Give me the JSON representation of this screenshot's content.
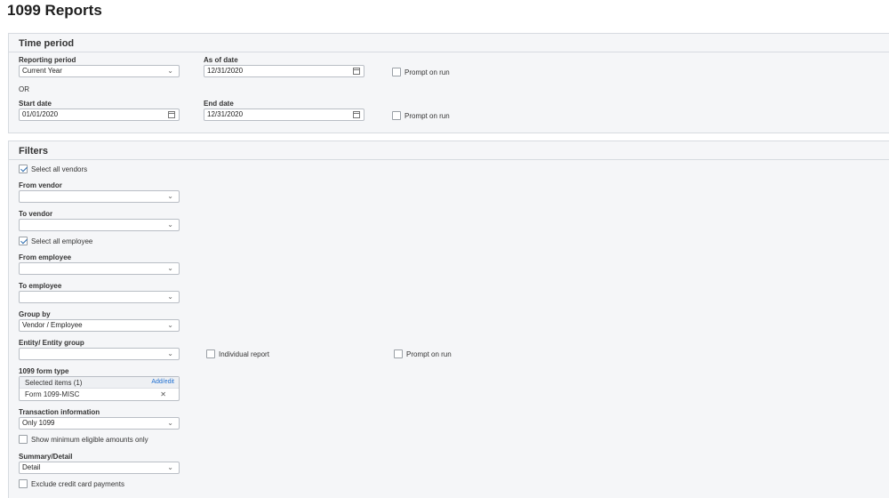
{
  "page": {
    "title": "1099 Reports"
  },
  "time_period": {
    "title": "Time period",
    "reporting_period_label": "Reporting period",
    "reporting_period_value": "Current Year",
    "as_of_date_label": "As of date",
    "as_of_date_value": "12/31/2020",
    "prompt_on_run_1": "Prompt on run",
    "or_label": "OR",
    "start_date_label": "Start date",
    "start_date_value": "01/01/2020",
    "end_date_label": "End date",
    "end_date_value": "12/31/2020",
    "prompt_on_run_2": "Prompt on run"
  },
  "filters": {
    "title": "Filters",
    "select_all_vendors": "Select all vendors",
    "select_all_vendors_checked": true,
    "from_vendor_label": "From vendor",
    "to_vendor_label": "To vendor",
    "select_all_employee": "Select all employee",
    "select_all_employee_checked": true,
    "from_employee_label": "From employee",
    "to_employee_label": "To employee",
    "group_by_label": "Group by",
    "group_by_value": "Vendor / Employee",
    "entity_group_label": "Entity/ Entity group",
    "individual_report": "Individual report",
    "prompt_on_run": "Prompt on run",
    "form_type_label": "1099 form type",
    "selected_items": "Selected items (1)",
    "add_edit": "Add/edit",
    "form_item": "Form 1099-MISC",
    "transaction_info_label": "Transaction information",
    "transaction_info_value": "Only 1099",
    "show_min_eligible": "Show minimum eligible amounts only",
    "summary_detail_label": "Summary/Detail",
    "summary_detail_value": "Detail",
    "exclude_credit_card": "Exclude credit card payments"
  },
  "icons": {
    "dropdown": "chevron-down-icon",
    "calendar": "calendar-icon",
    "remove": "close-icon",
    "check": "check-icon"
  },
  "glyphs": {
    "chevron": "⌄",
    "close": "✕"
  },
  "colors": {
    "link": "#1f6fd1",
    "panel_bg": "#f5f6f8",
    "border": "#d7dbe0"
  }
}
